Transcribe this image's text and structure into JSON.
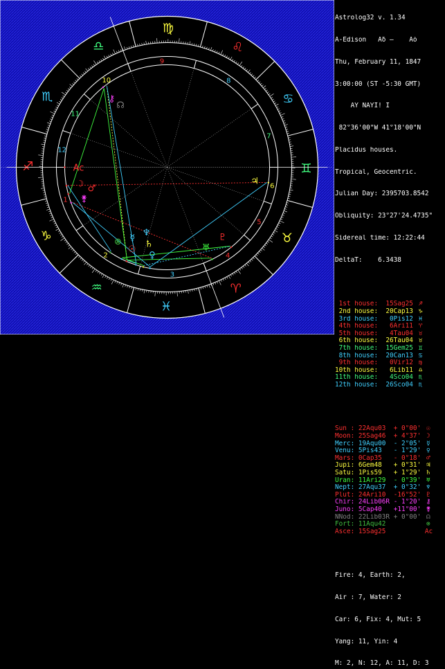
{
  "header": {
    "app_title": "Astrolog32 v. 1.34",
    "chart_name": "A-Edison",
    "name_glyphs": "Aδ –",
    "name_glyph2": "Aó",
    "date": "Thu, February 11, 1847",
    "time": "3:00:00 (ST -5:30 GMT)",
    "location_line": "ÀY NAYÌ! Ì",
    "coords": "82°36'00\"W 41°18'00\"N",
    "house_system": "Placidus houses.",
    "zodiac": "Tropical, Geocentric.",
    "julian_day": "Julian Day: 2395703.8542",
    "obliquity": "Obliquity: 23°27'24.4735\"",
    "sidereal": "Sidereal time: 12:22:44",
    "delta_t": "DeltaT:    6.3438"
  },
  "houses": [
    {
      "label": "1st house:",
      "value": "15Sag25",
      "glyph": "♐",
      "color": "#ff3030"
    },
    {
      "label": "2nd house:",
      "value": "20Cap13",
      "glyph": "♑",
      "color": "#ffff40"
    },
    {
      "label": "3rd house:",
      "value": "0Pis12",
      "glyph": "♓",
      "color": "#40d0ff"
    },
    {
      "label": "4th house:",
      "value": "6Ari11",
      "glyph": "♈",
      "color": "#ff3030"
    },
    {
      "label": "5th house:",
      "value": "4Tau04",
      "glyph": "♉",
      "color": "#ff3030"
    },
    {
      "label": "6th house:",
      "value": "26Tau04",
      "glyph": "♉",
      "color": "#ffff40"
    },
    {
      "label": "7th house:",
      "value": "15Gem25",
      "glyph": "♊",
      "color": "#40ff80"
    },
    {
      "label": "8th house:",
      "value": "20Can13",
      "glyph": "♋",
      "color": "#40d0ff"
    },
    {
      "label": "9th house:",
      "value": "0Vir12",
      "glyph": "♍",
      "color": "#ff3030"
    },
    {
      "label": "10th house:",
      "value": "6Lib11",
      "glyph": "♎",
      "color": "#ffff40"
    },
    {
      "label": "11th house:",
      "value": "4Sco04",
      "glyph": "♏",
      "color": "#40ff80"
    },
    {
      "label": "12th house:",
      "value": "26Sco04",
      "glyph": "♏",
      "color": "#40d0ff"
    }
  ],
  "planets": [
    {
      "name": "Sun :",
      "pos": "22Aqu03",
      "speed": "+ 0°00'",
      "glyph": "☉",
      "color": "#ff3030"
    },
    {
      "name": "Moon:",
      "pos": "25Sag46",
      "speed": "+ 4°37'",
      "glyph": "☽",
      "color": "#ff3030"
    },
    {
      "name": "Merc:",
      "pos": "19Aqu00",
      "speed": "- 2°05'",
      "glyph": "☿",
      "color": "#40d0ff"
    },
    {
      "name": "Venu:",
      "pos": "5Pis43",
      "speed": "- 1°29'",
      "glyph": "♀",
      "color": "#40d0ff"
    },
    {
      "name": "Mars:",
      "pos": "0Cap35",
      "speed": "- 0°18'",
      "glyph": "♂",
      "color": "#ff3030"
    },
    {
      "name": "Jupi:",
      "pos": "6Gem48",
      "speed": "+ 0°31'",
      "glyph": "♃",
      "color": "#ffff40"
    },
    {
      "name": "Satu:",
      "pos": "1Pis59",
      "speed": "+ 1°29'",
      "glyph": "♄",
      "color": "#ffff40"
    },
    {
      "name": "Uran:",
      "pos": "11Ari29",
      "speed": "- 0°39'",
      "glyph": "♅",
      "color": "#40ff40"
    },
    {
      "name": "Nept:",
      "pos": "27Aqu37",
      "speed": "+ 0°32'",
      "glyph": "♆",
      "color": "#40d0ff"
    },
    {
      "name": "Plut:",
      "pos": "24Ari10",
      "speed": "-16°52'",
      "glyph": "♇",
      "color": "#ff3030"
    },
    {
      "name": "Chir:",
      "pos": "24Lib06R",
      "speed": "- 1°20'",
      "glyph": "⚷",
      "color": "#ff40ff"
    },
    {
      "name": "Juno:",
      "pos": "5Cap40",
      "speed": "+11°00'",
      "glyph": "⚵",
      "color": "#ff40ff"
    },
    {
      "name": "NNod:",
      "pos": "22Lib03R",
      "speed": "+ 0°00'",
      "glyph": "☊",
      "color": "#808080"
    },
    {
      "name": "Fort:",
      "pos": "11Aqu42",
      "speed": "",
      "glyph": "⊗",
      "color": "#40c040"
    },
    {
      "name": "Asce:",
      "pos": "15Sag25",
      "speed": "",
      "glyph": "Ac",
      "color": "#ff3030"
    }
  ],
  "summary": {
    "elements1": "Fire: 4, Earth: 2,",
    "elements2": "Air : 7, Water: 2",
    "modes": "Car: 6, Fix: 4, Mut: 5",
    "yang": "Yang: 11, Yin: 4",
    "hemis": "M: 2, N: 12, A: 11, D: 3"
  },
  "wheel": {
    "sign_glyphs": [
      "♈",
      "♉",
      "♊",
      "♋",
      "♌",
      "♍",
      "♎",
      "♏",
      "♐",
      "♑",
      "♒",
      "♓"
    ],
    "sign_colors": [
      "#ff3030",
      "#ffff40",
      "#40ff80",
      "#40d0ff",
      "#ff3030",
      "#ffff40",
      "#40ff80",
      "#40d0ff",
      "#ff3030",
      "#ffff40",
      "#40ff80",
      "#40d0ff"
    ],
    "house_numbers": [
      "1",
      "2",
      "3",
      "4",
      "5",
      "6",
      "7",
      "8",
      "9",
      "10",
      "11",
      "12"
    ],
    "house_number_colors": [
      "#ff3030",
      "#ffff40",
      "#40d0ff",
      "#ff3030",
      "#ff3030",
      "#ffff40",
      "#40ff80",
      "#40d0ff",
      "#ff3030",
      "#ffff40",
      "#40ff80",
      "#40d0ff"
    ]
  },
  "colors": {
    "background": "#000000",
    "ring": "#1a1ad8",
    "wheel_line": "#ffffff"
  }
}
